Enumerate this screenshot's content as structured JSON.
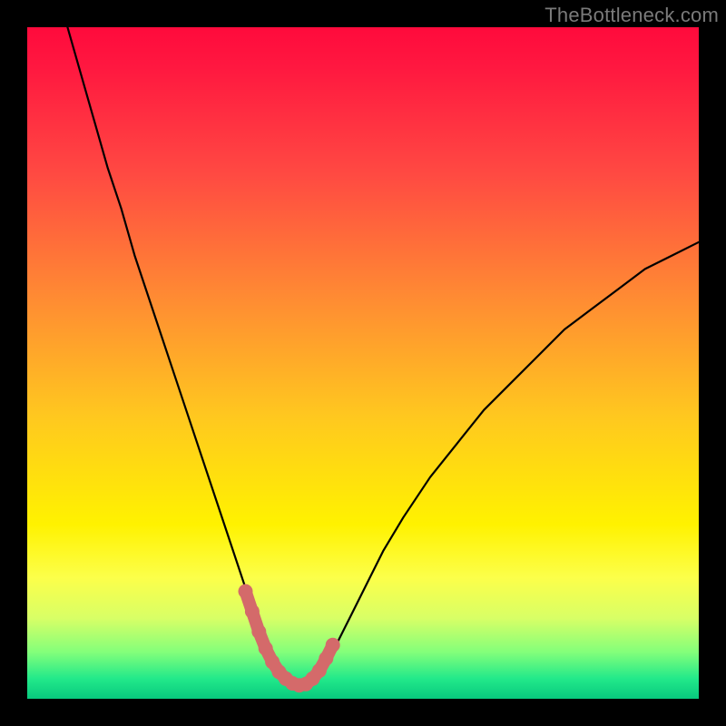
{
  "watermark": "TheBottleneck.com",
  "chart_data": {
    "type": "line",
    "title": "",
    "xlabel": "",
    "ylabel": "",
    "xlim": [
      0,
      100
    ],
    "ylim": [
      0,
      100
    ],
    "series": [
      {
        "name": "bottleneck-curve",
        "x": [
          6,
          8,
          10,
          12,
          14,
          16,
          18,
          20,
          22,
          24,
          26,
          28,
          30,
          32,
          33,
          34,
          35,
          36,
          37,
          38,
          39,
          40,
          41,
          42,
          43,
          44,
          46,
          48,
          50,
          53,
          56,
          60,
          64,
          68,
          72,
          76,
          80,
          84,
          88,
          92,
          96,
          100
        ],
        "y": [
          100,
          93,
          86,
          79,
          73,
          66,
          60,
          54,
          48,
          42,
          36,
          30,
          24,
          18,
          15,
          12,
          9,
          7,
          5,
          3.5,
          2.5,
          2,
          2,
          2.5,
          3.5,
          5,
          8,
          12,
          16,
          22,
          27,
          33,
          38,
          43,
          47,
          51,
          55,
          58,
          61,
          64,
          66,
          68
        ]
      }
    ],
    "highlight": {
      "name": "valley-highlight",
      "color": "#d46a6a",
      "x": [
        32.5,
        33.5,
        34.5,
        35.5,
        36.5,
        37.5,
        38.5,
        39.5,
        40.5,
        41.5,
        42.5,
        43.5,
        44.5,
        45.5
      ],
      "y": [
        16,
        13,
        10,
        7.5,
        5.5,
        4,
        3,
        2.3,
        2,
        2.2,
        3,
        4.2,
        6,
        8
      ]
    }
  }
}
